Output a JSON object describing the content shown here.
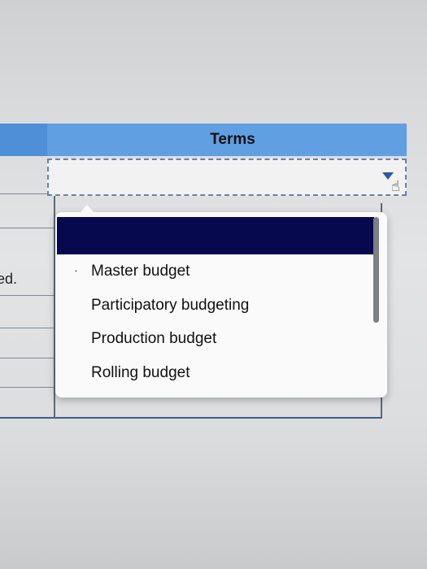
{
  "table": {
    "column_header": "Terms",
    "left_cell_text": "ed."
  },
  "dropdown": {
    "selected_option": "",
    "options": [
      "Master budget",
      "Participatory budgeting",
      "Production budget",
      "Rolling budget"
    ]
  },
  "colors": {
    "header": "#5f9fe2",
    "selected": "#07094e",
    "accent": "#2b5aa0"
  },
  "icons": {
    "arrow": "dropdown-arrow-icon",
    "cursor": "hand-cursor-icon"
  }
}
